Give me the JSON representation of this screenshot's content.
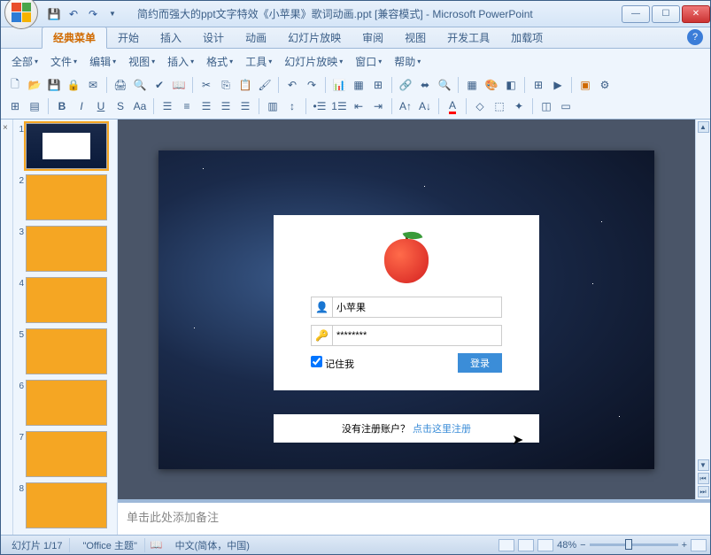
{
  "titlebar": {
    "title": "简约而强大的ppt文字特效《小苹果》歌词动画.ppt [兼容模式] - Microsoft PowerPoint"
  },
  "ribbon": {
    "tabs": [
      "经典菜单",
      "开始",
      "插入",
      "设计",
      "动画",
      "幻灯片放映",
      "审阅",
      "视图",
      "开发工具",
      "加载项"
    ],
    "active_tab": 0,
    "menus": [
      "全部",
      "文件",
      "编辑",
      "视图",
      "插入",
      "格式",
      "工具",
      "幻灯片放映",
      "窗口",
      "帮助"
    ]
  },
  "thumbs": {
    "count": 8,
    "selected": 1
  },
  "slide": {
    "login": {
      "username": "小苹果",
      "password": "********",
      "remember_label": "记住我",
      "login_btn": "登录",
      "no_account": "没有注册账户？",
      "register_link": "点击这里注册"
    }
  },
  "notes": {
    "placeholder": "单击此处添加备注"
  },
  "statusbar": {
    "slide_indicator": "幻灯片 1/17",
    "theme": "\"Office 主题\"",
    "language": "中文(简体，中国)",
    "zoom": "48%"
  }
}
